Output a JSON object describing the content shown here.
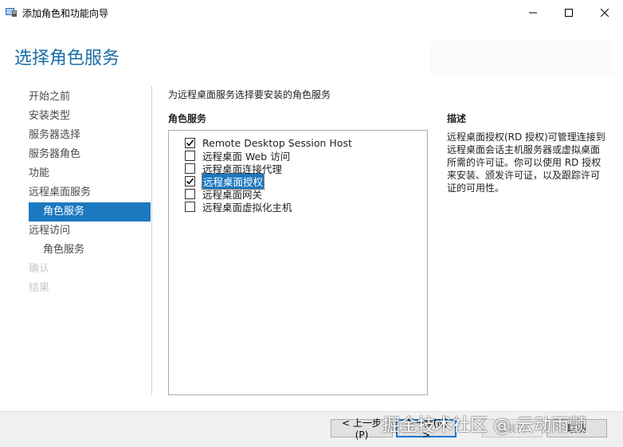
{
  "window": {
    "title": "添加角色和功能向导",
    "icon": "server-manager-icon"
  },
  "header": {
    "title": "选择角色服务"
  },
  "nav": {
    "items": [
      {
        "label": "开始之前",
        "state": "normal"
      },
      {
        "label": "安装类型",
        "state": "normal"
      },
      {
        "label": "服务器选择",
        "state": "normal"
      },
      {
        "label": "服务器角色",
        "state": "normal"
      },
      {
        "label": "功能",
        "state": "normal"
      },
      {
        "label": "远程桌面服务",
        "state": "normal"
      },
      {
        "label": "角色服务",
        "state": "active"
      },
      {
        "label": "远程访问",
        "state": "normal"
      },
      {
        "label": "角色服务",
        "state": "sub"
      },
      {
        "label": "确认",
        "state": "disabled"
      },
      {
        "label": "结果",
        "state": "disabled"
      }
    ]
  },
  "main": {
    "intro": "为远程桌面服务选择要安装的角色服务",
    "roles_heading": "角色服务",
    "roles": [
      {
        "label": "Remote Desktop Session Host",
        "checked": true,
        "selected": false
      },
      {
        "label": "远程桌面 Web 访问",
        "checked": false,
        "selected": false
      },
      {
        "label": "远程桌面连接代理",
        "checked": false,
        "selected": false
      },
      {
        "label": "远程桌面授权",
        "checked": true,
        "selected": true
      },
      {
        "label": "远程桌面网关",
        "checked": false,
        "selected": false
      },
      {
        "label": "远程桌面虚拟化主机",
        "checked": false,
        "selected": false
      }
    ]
  },
  "description": {
    "heading": "描述",
    "text": "远程桌面授权(RD 授权)可管理连接到远程桌面会话主机服务器或虚拟桌面所需的许可证。你可以使用 RD 授权来安装、颁发许可证，以及跟踪许可证的可用性。"
  },
  "footer": {
    "prev_label": "< 上一步(P)",
    "next_label": "下一步(N) >",
    "install_label": "安装(I)",
    "cancel_label": "取消"
  },
  "watermark": "掘金技术社区 @ 云动雨颤",
  "colors": {
    "accent": "#1c79c0",
    "title_blue": "#1a6ea8"
  }
}
